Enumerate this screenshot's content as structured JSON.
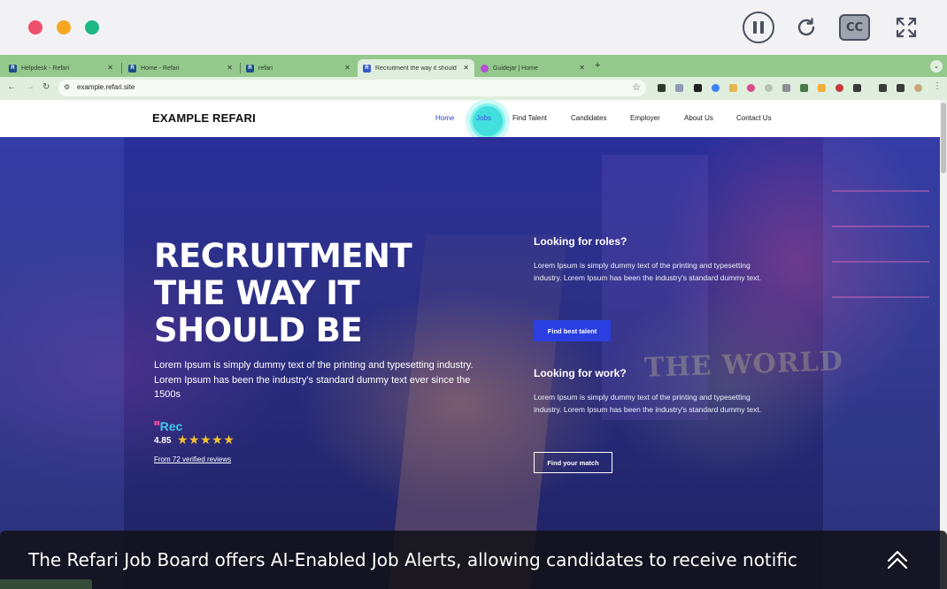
{
  "player": {
    "controls": [
      "pause",
      "reload",
      "captions",
      "fullscreen"
    ],
    "cc_label": "CC"
  },
  "browser": {
    "tabs": [
      {
        "title": "Helpdesk - Refari",
        "active": false
      },
      {
        "title": "Home - Refari",
        "active": false
      },
      {
        "title": "refari",
        "active": false
      },
      {
        "title": "Recruitment the way it should",
        "active": true
      },
      {
        "title": "Guidejar | Home",
        "active": false
      }
    ],
    "url": "example.refari.site"
  },
  "site": {
    "logo": "EXAMPLE REFARI",
    "menu": [
      "Home",
      "Jobs",
      "Find Talent",
      "Candidates",
      "Employer",
      "About Us",
      "Contact Us"
    ],
    "hero": {
      "headline_lines": [
        "RECRUITMENT",
        "THE WAY IT",
        "SHOULD BE"
      ],
      "lead": "Lorem Ipsum is simply dummy text of the printing and typesetting industry. Lorem Ipsum has been the industry's standard dummy text ever since the 1500s",
      "rec_badge": "Rec",
      "rating": "4.85",
      "stars": 5,
      "reviews": "From 72 verified reviews",
      "watermark": "THE WORLD"
    },
    "cards": [
      {
        "title": "Looking for roles?",
        "text": "Lorem Ipsum is simply dummy text of the printing and typesetting industry. Lorem Ipsum has been the industry's standard dummy text.",
        "button": "Find best talent"
      },
      {
        "title": "Looking for work?",
        "text": "Lorem Ipsum is simply dummy text of the printing and typesetting industry. Lorem Ipsum has been the industry's standard dummy text.",
        "button": "Find your match"
      }
    ]
  },
  "caption": "The Refari Job Board offers AI-Enabled Job Alerts, allowing candidates to receive notific",
  "colors": {
    "accent": "#2b3fe0",
    "chrome": "#94c98c",
    "click_highlight": "#28dcd7"
  }
}
